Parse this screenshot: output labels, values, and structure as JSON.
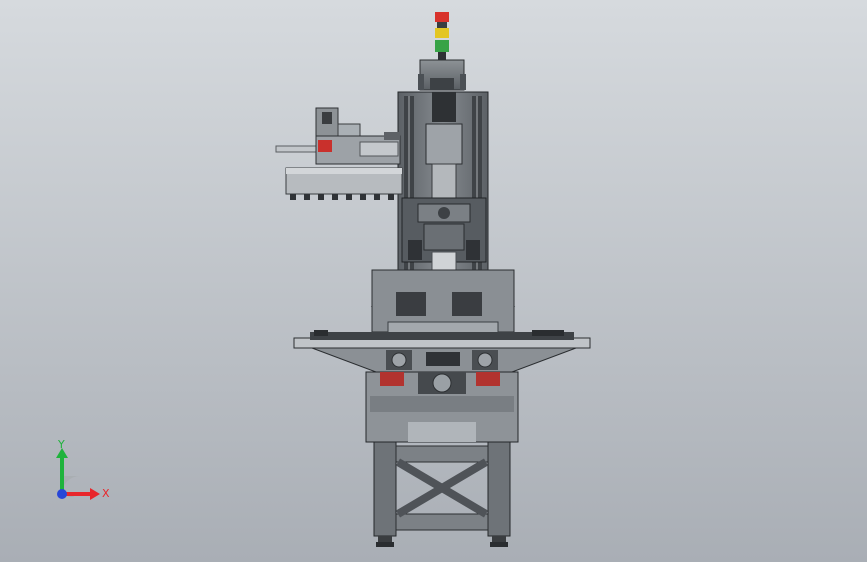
{
  "viewport": {
    "background_top": "#d6dade",
    "background_bottom": "#a9aeb5"
  },
  "triad": {
    "x_label": "X",
    "y_label": "Y",
    "x_color": "#e8262b",
    "y_color": "#1fb33c",
    "z_color": "#2746d8",
    "icon": "coordinate-triad-icon"
  },
  "signal_tower": {
    "colors": [
      "#d8322b",
      "#e3c622",
      "#37a346"
    ],
    "icon": "signal-light-icon"
  },
  "model": {
    "name": "cnc-vertical-machining-center",
    "parts": [
      "tool-changer",
      "spindle-column",
      "worktable",
      "base",
      "stand"
    ]
  }
}
